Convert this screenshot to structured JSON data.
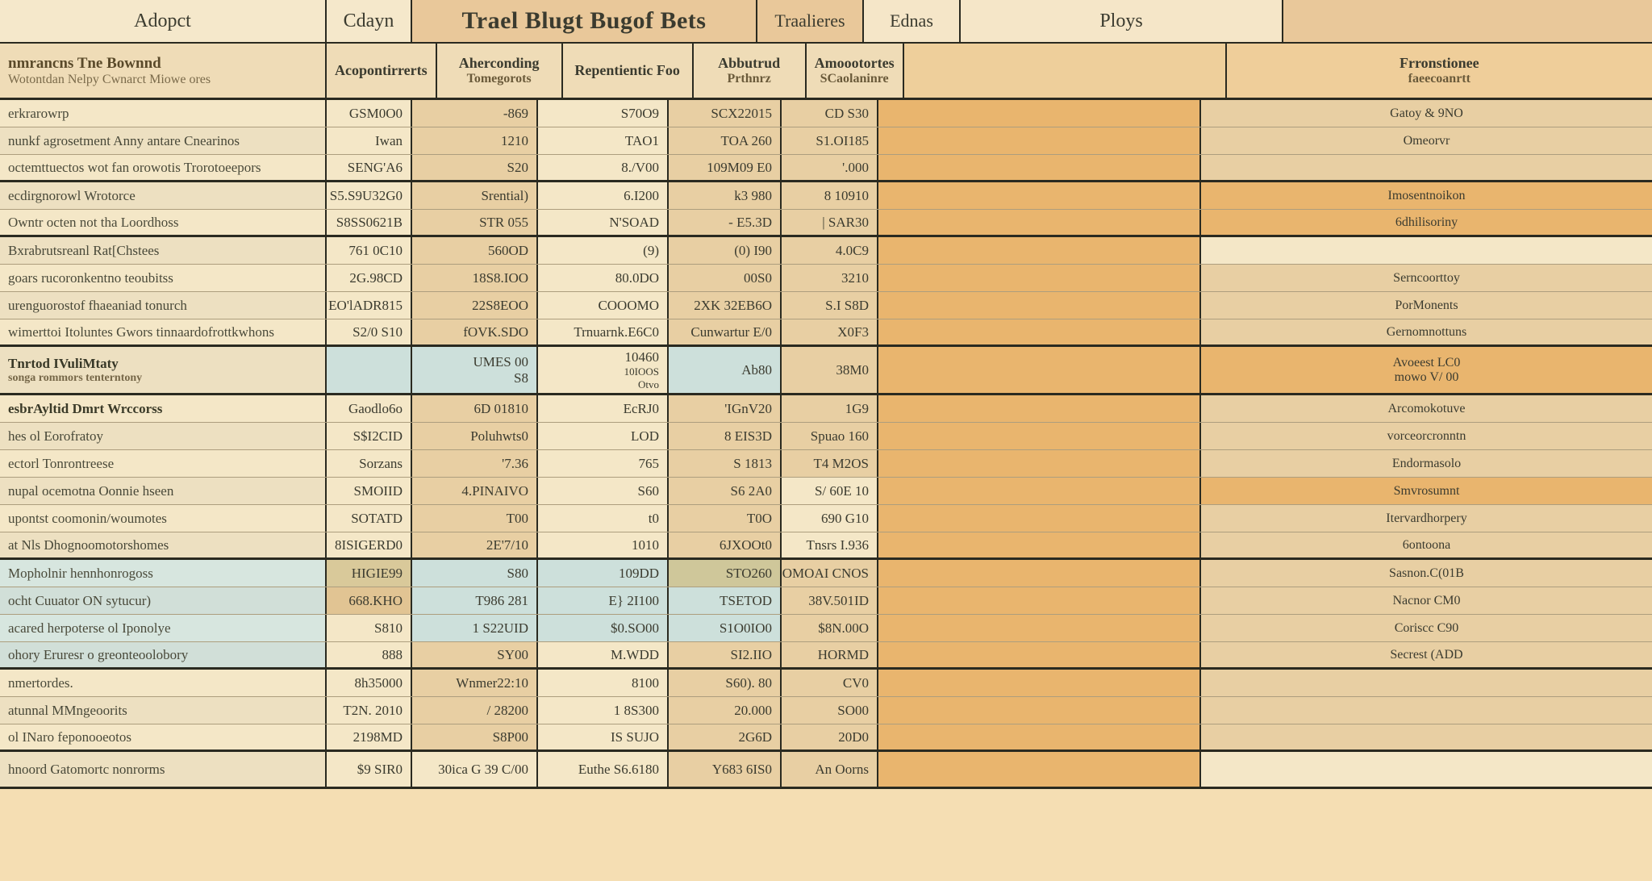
{
  "tabs": {
    "t1": "Adopct",
    "t2": "Cdayn",
    "t3": "Trael Blugt Bugof Bets",
    "t4": "Traalieres",
    "t5": "Ednas",
    "t6": "Ploys"
  },
  "colheads": {
    "c0_line1": "nmrancns Tne Bownnd",
    "c0_line2": "Wotontdan Nelpy Cwnarct Miowe ores",
    "c1_line1": "Acopontirrerts",
    "c2_line1": "Aherconding",
    "c2_line2": "Tomegorots",
    "c3_line1": "Repentientic Foo",
    "c4_line1": "Abbutrud",
    "c4_line2": "Prthnrz",
    "c5_line1": "Amoootortes",
    "c5_line2": "SCaolaninre",
    "c7_line1": "Frronstionee",
    "c7_line2": "faeecoanrtt"
  },
  "rows": [
    {
      "c0": "erkrarowrp",
      "c1": "GSM0O0",
      "c2": "-869",
      "c3": "S70O9",
      "c4": "SCX22015",
      "c5": "CD S30",
      "c7": "Gatoy & 9NO",
      "bg": {
        "c0": "bg-cream",
        "c1": "bg-cream",
        "c2": "bg-tan",
        "c3": "bg-cream",
        "c4": "bg-tan",
        "c5": "bg-tan",
        "c6": "bg-orange",
        "c7": "bg-tan"
      }
    },
    {
      "c0": "nunkf agrosetment Anny antare Cnearinos",
      "c1": "Iwan",
      "c2": "1210",
      "c3": "TAO1",
      "c4": "TOA 260",
      "c5": "S1.OI185",
      "c7": "Omeorvr",
      "bg": {
        "c0": "bg-cream",
        "c1": "bg-cream",
        "c2": "bg-tan",
        "c3": "bg-cream",
        "c4": "bg-tan",
        "c5": "bg-tan",
        "c6": "bg-orange",
        "c7": "bg-tan"
      }
    },
    {
      "c0": "octemttuectos wot fan orowotis Trorotoeepors",
      "c1": "SENG'A6",
      "c2": "S20",
      "c3": "8./V00",
      "c4": "109M09 E0",
      "c5": "'.000",
      "c7": "",
      "bg": {
        "c0": "bg-cream",
        "c1": "bg-cream",
        "c2": "bg-tan",
        "c3": "bg-cream",
        "c4": "bg-tan",
        "c5": "bg-tan",
        "c6": "bg-orange",
        "c7": "bg-tan"
      },
      "thickBot": true
    },
    {
      "c0": "ecdirgnorowl Wrotorce",
      "c1": "S5.S9U32G0",
      "c2": "Srential)",
      "c3": "6.I200",
      "c4": "k3 980",
      "c5": "8 10910",
      "c7": "Imosentnoikon",
      "bg": {
        "c0": "bg-cream",
        "c1": "bg-cream",
        "c2": "bg-tan",
        "c3": "bg-cream",
        "c4": "bg-tan",
        "c5": "bg-tan",
        "c6": "bg-orange",
        "c7": "bg-orange"
      }
    },
    {
      "c0": "Owntr octen not tha Loordhoss",
      "c1": "S8SS0621B",
      "c2": "STR 055",
      "c3": "N'SOAD",
      "c4": "- E5.3D",
      "c5": "| SAR30",
      "c7": "6dhilisoriny",
      "bg": {
        "c0": "bg-cream",
        "c1": "bg-cream",
        "c2": "bg-tan",
        "c3": "bg-cream",
        "c4": "bg-tan",
        "c5": "bg-tan",
        "c6": "bg-orange",
        "c7": "bg-orange"
      },
      "thickBot": true
    },
    {
      "c0": "Bxrabrutsreanl Rat[Chstees",
      "c1": "761 0C10",
      "c2": "560OD",
      "c3": "(9)",
      "c4": "(0) I90",
      "c5": "4.0C9",
      "c7": "",
      "bg": {
        "c0": "bg-cream",
        "c1": "bg-cream",
        "c2": "bg-tan",
        "c3": "bg-cream",
        "c4": "bg-tan",
        "c5": "bg-tan",
        "c6": "bg-orange",
        "c7": "bg-cream"
      }
    },
    {
      "c0": "goars rucoronkentno teoubitss",
      "c1": "2G.98CD",
      "c2": "18S8.IOO",
      "c3": "80.0DO",
      "c4": "00S0",
      "c5": "3210",
      "c7": "Serncoorttoy",
      "bg": {
        "c0": "bg-cream",
        "c1": "bg-cream",
        "c2": "bg-tan",
        "c3": "bg-cream",
        "c4": "bg-tan",
        "c5": "bg-tan",
        "c6": "bg-orange",
        "c7": "bg-tan"
      }
    },
    {
      "c0": "urenguorostof fhaeaniad tonurch",
      "c1": "EO'lADR815",
      "c2": "22S8EOO",
      "c3": "COOOMO",
      "c4": "2XK 32EB6O",
      "c5": "S.I S8D",
      "c7": "PorMonents",
      "bg": {
        "c0": "bg-cream",
        "c1": "bg-cream",
        "c2": "bg-tan",
        "c3": "bg-cream",
        "c4": "bg-tan",
        "c5": "bg-tan",
        "c6": "bg-orange",
        "c7": "bg-tan"
      }
    },
    {
      "c0": "wimerttoi Itoluntes Gwors tinnaardofrottkwhons",
      "c1": "S2/0 S10",
      "c2": "fOVK.SDO",
      "c3": "Trnuarnk.E6C0",
      "c4": "Cunwartur E/0",
      "c5": "X0F3",
      "c7": "Gernomnottuns",
      "bg": {
        "c0": "bg-cream",
        "c1": "bg-cream",
        "c2": "bg-tan",
        "c3": "bg-cream",
        "c4": "bg-tan",
        "c5": "bg-tan",
        "c6": "bg-orange",
        "c7": "bg-tan"
      },
      "thickBot": true
    },
    {
      "bold": true,
      "xtall": true,
      "c0": "Tnrtod IVuliMtaty",
      "c0b": "songa rommors tenterntony",
      "c1": "",
      "c2": "UMES 00",
      "c2b": "S8",
      "c3": "10460",
      "c3b": "10IOOS\nOtvo",
      "c4": "Ab80",
      "c5": "38M0",
      "c7": "Avoeest LC0",
      "c7b": "mowo V/ 00",
      "bg": {
        "c0": "bg-cream",
        "c1": "bg-mint",
        "c2": "bg-mint",
        "c3": "bg-cream",
        "c4": "bg-mint",
        "c5": "bg-tan",
        "c6": "bg-orange",
        "c7": "bg-orange"
      },
      "thickBot": true
    },
    {
      "bold": true,
      "c0": "esbrAyltid Dmrt Wrccorss",
      "c1": "Gaodlo6o",
      "c2": "6D 01810",
      "c3": "EcRJ0",
      "c4": "'IGnV20",
      "c5": "1G9",
      "c7": "Arcomokotuve",
      "bg": {
        "c0": "bg-cream",
        "c1": "bg-cream",
        "c2": "bg-tan",
        "c3": "bg-cream",
        "c4": "bg-tan",
        "c5": "bg-tan",
        "c6": "bg-orange",
        "c7": "bg-tan"
      }
    },
    {
      "c0": "hes ol Eorofratoy",
      "c1": "S$I2CID",
      "c2": "Poluhwts0",
      "c3": "LOD",
      "c4": "8 EIS3D",
      "c5": "Spuao 160",
      "c7": "vorceorcronntn",
      "bg": {
        "c0": "bg-cream",
        "c1": "bg-cream",
        "c2": "bg-tan",
        "c3": "bg-cream",
        "c4": "bg-tan",
        "c5": "bg-tan",
        "c6": "bg-orange",
        "c7": "bg-tan"
      }
    },
    {
      "c0": "ectorl Tonrontreese",
      "c1": "Sorzans",
      "c2": "'7.36",
      "c3": "765",
      "c4": "S 1813",
      "c5": "T4 M2OS",
      "c7": "Endormasolo",
      "bg": {
        "c0": "bg-cream",
        "c1": "bg-cream",
        "c2": "bg-tan",
        "c3": "bg-cream",
        "c4": "bg-tan",
        "c5": "bg-tan",
        "c6": "bg-orange",
        "c7": "bg-tan"
      }
    },
    {
      "c0": "nupal ocemotna Oonnie hseen",
      "c1": "SMOIID",
      "c2": "4.PINAIVO",
      "c3": "S60",
      "c4": "S6 2A0",
      "c5": "S/ 60E 10",
      "c7": "Smvrosumnt",
      "bg": {
        "c0": "bg-cream",
        "c1": "bg-cream",
        "c2": "bg-tan",
        "c3": "bg-cream",
        "c4": "bg-tan",
        "c5": "bg-cream",
        "c6": "bg-orange",
        "c7": "bg-orange"
      }
    },
    {
      "c0": "upontst coomonin/woumotes",
      "c1": "SOTATD",
      "c2": "T00",
      "c3": "t0",
      "c4": "T0O",
      "c5": "690   G10",
      "c7": "Itervardhorpery",
      "bg": {
        "c0": "bg-cream",
        "c1": "bg-cream",
        "c2": "bg-tan",
        "c3": "bg-cream",
        "c4": "bg-tan",
        "c5": "bg-cream",
        "c6": "bg-orange",
        "c7": "bg-tan"
      }
    },
    {
      "c0": "at Nls Dhognoomotorshomes",
      "c1": "8ISIGERD0",
      "c2": "2E'7/10",
      "c3": "1010",
      "c4": "6JXOOt0",
      "c5": "Tnsrs I.936",
      "c7": "6ontoona",
      "bg": {
        "c0": "bg-cream",
        "c1": "bg-cream",
        "c2": "bg-tan",
        "c3": "bg-cream",
        "c4": "bg-tan",
        "c5": "bg-cream",
        "c6": "bg-orange",
        "c7": "bg-tan"
      },
      "thickBot": true
    },
    {
      "c0": "Mopholnir hennhonrogoss",
      "c1": "HIGIE99",
      "c2": "S80",
      "c3": "109DD",
      "c4": "STO260",
      "c5": "SOMOAI CNOS",
      "c7": "Sasnon.C(01B",
      "bg": {
        "c0": "bg-mint2",
        "c1": "bg-khaki",
        "c2": "bg-mint",
        "c3": "bg-mint",
        "c4": "bg-olive",
        "c5": "bg-tan",
        "c6": "bg-orange",
        "c7": "bg-tan"
      }
    },
    {
      "c0": "ocht Cuuator ON sytucur)",
      "c1": "668.KHO",
      "c2": "T986 281",
      "c3": "E} 2I100",
      "c4": "TSETOD",
      "c5": "38V.501ID",
      "c7": "Nacnor CM0",
      "bg": {
        "c0": "bg-mint2",
        "c1": "bg-tan2",
        "c2": "bg-mint",
        "c3": "bg-mint",
        "c4": "bg-mint",
        "c5": "bg-tan",
        "c6": "bg-orange",
        "c7": "bg-tan"
      }
    },
    {
      "c0": "acared herpoterse ol Iponolye",
      "c1": "S810",
      "c2": "1 S22UID",
      "c3": "$0.SO00",
      "c4": "S1O0IO0",
      "c5": "$8N.00O",
      "c7": "Coriscc C90",
      "bg": {
        "c0": "bg-mint2",
        "c1": "bg-cream",
        "c2": "bg-mint",
        "c3": "bg-mint",
        "c4": "bg-mint",
        "c5": "bg-tan",
        "c6": "bg-orange",
        "c7": "bg-tan"
      }
    },
    {
      "c0": "ohory Eruresr o greonteoolobory",
      "c1": "888",
      "c2": "SY00",
      "c3": "M.WDD",
      "c4": "SI2.IIO",
      "c5": "HORMD",
      "c7": "Secrest (ADD",
      "bg": {
        "c0": "bg-mint2",
        "c1": "bg-cream",
        "c2": "bg-tan",
        "c3": "bg-cream",
        "c4": "bg-tan",
        "c5": "bg-tan",
        "c6": "bg-orange",
        "c7": "bg-tan"
      },
      "thickBot": true
    },
    {
      "c0": "nmertordes.",
      "c1": "8h35000",
      "c2": "Wnmer22:10",
      "c3": "8100",
      "c4": "S60). 80",
      "c5": "CV0",
      "c7": "",
      "bg": {
        "c0": "bg-cream",
        "c1": "bg-cream",
        "c2": "bg-tan",
        "c3": "bg-cream",
        "c4": "bg-tan",
        "c5": "bg-tan",
        "c6": "bg-orange",
        "c7": "bg-tan"
      }
    },
    {
      "c0": "atunnal MMngeoorits",
      "c1": "T2N. 2010",
      "c2": "/ 28200",
      "c3": "1 8S300",
      "c4": "20.000",
      "c5": "SO00",
      "c7": "",
      "bg": {
        "c0": "bg-cream",
        "c1": "bg-cream",
        "c2": "bg-tan",
        "c3": "bg-cream",
        "c4": "bg-tan",
        "c5": "bg-tan",
        "c6": "bg-orange",
        "c7": "bg-tan"
      }
    },
    {
      "c0": "ol INaro feponooeotos",
      "c1": "2198MD",
      "c2": "S8P00",
      "c3": "IS SUJO",
      "c4": "2G6D",
      "c5": "20D0",
      "c7": "",
      "bg": {
        "c0": "bg-cream",
        "c1": "bg-cream",
        "c2": "bg-tan",
        "c3": "bg-cream",
        "c4": "bg-tan",
        "c5": "bg-tan",
        "c6": "bg-orange",
        "c7": "bg-tan"
      },
      "thickBot": true
    },
    {
      "tall": true,
      "c0": "hnoord Gatomortc nonrorms",
      "c1": "$9 SIR0",
      "c2": "30ica G 39 C/00",
      "c3": "Euthe S6.6180",
      "c4": "Y683 6IS0",
      "c5": "An Oorns",
      "c7": "",
      "bg": {
        "c0": "bg-cream",
        "c1": "bg-cream",
        "c2": "bg-cream",
        "c3": "bg-cream",
        "c4": "bg-tan",
        "c5": "bg-tan",
        "c6": "bg-orange",
        "c7": "bg-cream"
      },
      "thickBot": true
    }
  ]
}
